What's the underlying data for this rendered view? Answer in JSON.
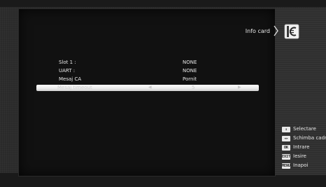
{
  "header": {
    "title": "Info card"
  },
  "rows": [
    {
      "label": "Slot 1 :",
      "value": "NONE"
    },
    {
      "label": "UART :",
      "value": "NONE"
    },
    {
      "label": "Mesaj CA",
      "value": "Pornit"
    },
    {
      "label": "Mesaj timeout",
      "value": "5"
    }
  ],
  "legend": [
    {
      "icon": "up-down-icon",
      "key": "↕",
      "label": "Selectare"
    },
    {
      "icon": "left-right-icon",
      "key": "◂▸",
      "label": "Schimba cadr"
    },
    {
      "icon": "ok-button-icon",
      "key": "OK",
      "label": "Intrare"
    },
    {
      "icon": "exit-button-icon",
      "key": "EXIT",
      "label": "Iesire"
    },
    {
      "icon": "menu-button-icon",
      "key": "MENU",
      "label": "Inapoi"
    }
  ],
  "colors": {
    "background": "#2a2a2a",
    "panel": "#111111",
    "highlight": "#f2f2f2",
    "text": "#e6e6e6"
  }
}
